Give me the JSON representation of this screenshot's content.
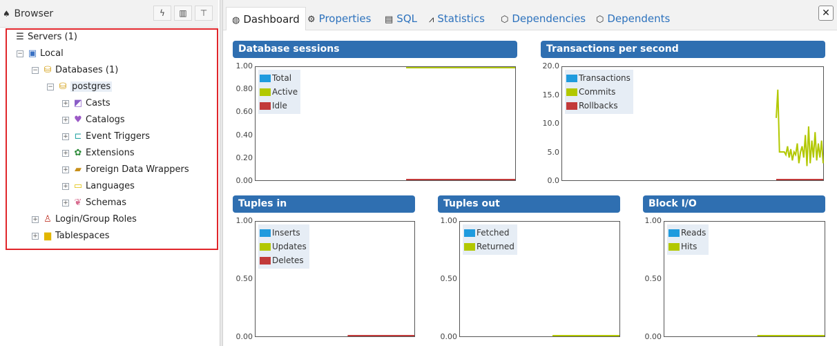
{
  "browser": {
    "title": "Browser",
    "header_buttons": [
      "lightning-icon",
      "grid-icon",
      "filter-icon"
    ],
    "tree": [
      {
        "label": "Servers (1)",
        "icon": "servers-icon",
        "expander": ""
      },
      {
        "label": "Local",
        "icon": "server-icon",
        "expander": "−"
      },
      {
        "label": "Databases (1)",
        "icon": "databases-icon",
        "expander": "−"
      },
      {
        "label": "postgres",
        "icon": "database-icon",
        "expander": "−"
      },
      {
        "label": "Casts",
        "icon": "casts-icon",
        "expander": "+"
      },
      {
        "label": "Catalogs",
        "icon": "catalogs-icon",
        "expander": "+"
      },
      {
        "label": "Event Triggers",
        "icon": "event-triggers-icon",
        "expander": "+"
      },
      {
        "label": "Extensions",
        "icon": "extensions-icon",
        "expander": "+"
      },
      {
        "label": "Foreign Data Wrappers",
        "icon": "fdw-icon",
        "expander": "+"
      },
      {
        "label": "Languages",
        "icon": "languages-icon",
        "expander": "+"
      },
      {
        "label": "Schemas",
        "icon": "schemas-icon",
        "expander": "+"
      },
      {
        "label": "Login/Group Roles",
        "icon": "roles-icon",
        "expander": "+"
      },
      {
        "label": "Tablespaces",
        "icon": "tablespaces-icon",
        "expander": "+"
      }
    ]
  },
  "tabs": [
    {
      "label": "Dashboard",
      "icon": "dashboard-icon",
      "active": true
    },
    {
      "label": "Properties",
      "icon": "properties-icon",
      "active": false
    },
    {
      "label": "SQL",
      "icon": "sql-icon",
      "active": false
    },
    {
      "label": "Statistics",
      "icon": "statistics-icon",
      "active": false
    },
    {
      "label": "Dependencies",
      "icon": "dependencies-icon",
      "active": false
    },
    {
      "label": "Dependents",
      "icon": "dependents-icon",
      "active": false
    }
  ],
  "close_label": "✕",
  "colors": {
    "blue": "#1f9bde",
    "green": "#b2c800",
    "red": "#c23a3a",
    "title_bar": "#2f6fb1"
  },
  "chart_data": [
    {
      "type": "line",
      "title": "Database sessions",
      "ylim": [
        0,
        1
      ],
      "yticks": [
        "1.00",
        "0.80",
        "0.60",
        "0.40",
        "0.20",
        "0.00"
      ],
      "series": [
        {
          "name": "Total",
          "color": "#1f9bde",
          "values": []
        },
        {
          "name": "Active",
          "color": "#b2c800",
          "values": [
            1,
            1,
            1,
            1,
            1,
            1
          ]
        },
        {
          "name": "Idle",
          "color": "#c23a3a",
          "values": [
            0,
            0,
            0,
            0,
            0,
            0
          ]
        }
      ]
    },
    {
      "type": "line",
      "title": "Transactions per second",
      "ylim": [
        0,
        20
      ],
      "yticks": [
        "20.0",
        "15.0",
        "10.0",
        "5.0",
        "0.0"
      ],
      "series": [
        {
          "name": "Transactions",
          "color": "#1f9bde",
          "values": []
        },
        {
          "name": "Commits",
          "color": "#b2c800",
          "values": [
            11,
            16,
            5,
            5,
            5,
            5,
            4.5,
            6,
            4,
            5.5,
            3.5,
            5,
            4.5,
            6.5,
            3,
            5,
            6,
            4,
            8,
            2.5,
            9.5,
            3,
            7,
            4,
            8.5,
            3.5,
            6.5,
            4,
            7,
            3
          ]
        },
        {
          "name": "Rollbacks",
          "color": "#c23a3a",
          "values": [
            0,
            0,
            0,
            0,
            0,
            0,
            0,
            0,
            0,
            0,
            0,
            0,
            0,
            0,
            0,
            0,
            0,
            0,
            0,
            0,
            0,
            0,
            0,
            0,
            0,
            0,
            0,
            0,
            0,
            0
          ]
        }
      ]
    },
    {
      "type": "line",
      "title": "Tuples in",
      "ylim": [
        0,
        1
      ],
      "yticks": [
        "1.00",
        "0.50",
        "0.00"
      ],
      "series": [
        {
          "name": "Inserts",
          "color": "#1f9bde",
          "values": []
        },
        {
          "name": "Updates",
          "color": "#b2c800",
          "values": []
        },
        {
          "name": "Deletes",
          "color": "#c23a3a",
          "values": [
            0,
            0,
            0,
            0,
            0,
            0
          ]
        }
      ]
    },
    {
      "type": "line",
      "title": "Tuples out",
      "ylim": [
        0,
        1
      ],
      "yticks": [
        "1.00",
        "0.50",
        "0.00"
      ],
      "series": [
        {
          "name": "Fetched",
          "color": "#1f9bde",
          "values": []
        },
        {
          "name": "Returned",
          "color": "#b2c800",
          "values": [
            0,
            0,
            0,
            0,
            0,
            0
          ]
        }
      ]
    },
    {
      "type": "line",
      "title": "Block I/O",
      "ylim": [
        0,
        1
      ],
      "yticks": [
        "1.00",
        "0.50",
        "0.00"
      ],
      "series": [
        {
          "name": "Reads",
          "color": "#1f9bde",
          "values": []
        },
        {
          "name": "Hits",
          "color": "#b2c800",
          "values": [
            0,
            0,
            0,
            0,
            0,
            0
          ]
        }
      ]
    }
  ]
}
